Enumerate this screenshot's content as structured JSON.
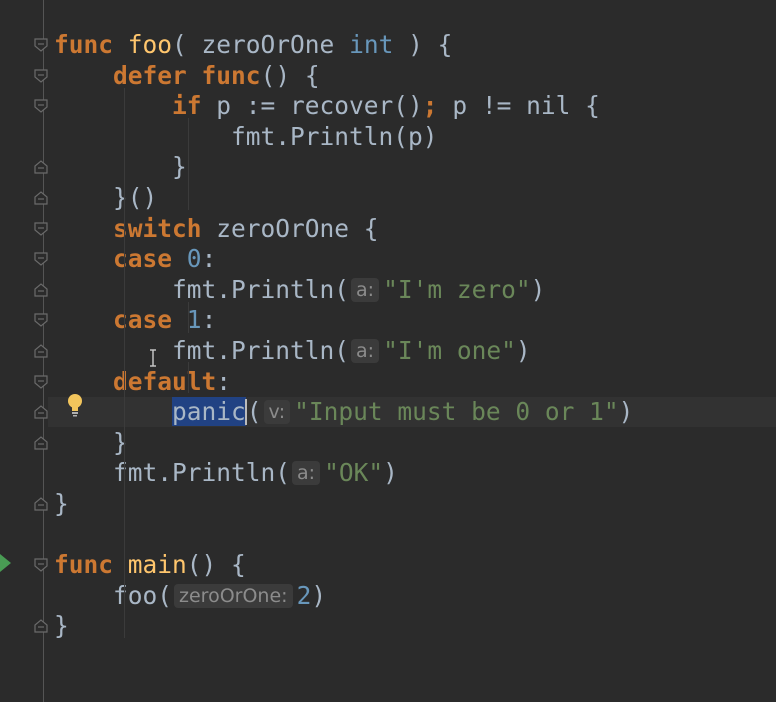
{
  "editor": {
    "lines": [
      {
        "tokens": [
          {
            "t": "func",
            "c": "kw"
          },
          {
            "t": " "
          },
          {
            "t": "foo",
            "c": "fn"
          },
          {
            "t": "( zeroOrOne "
          },
          {
            "t": "int",
            "c": "num"
          },
          {
            "t": " ) {"
          }
        ]
      },
      {
        "tokens": [
          {
            "t": "    "
          },
          {
            "t": "defer",
            "c": "kw"
          },
          {
            "t": " "
          },
          {
            "t": "func",
            "c": "kw"
          },
          {
            "t": "() {"
          }
        ]
      },
      {
        "tokens": [
          {
            "t": "        "
          },
          {
            "t": "if",
            "c": "kw"
          },
          {
            "t": " p := recover()"
          },
          {
            "t": ";",
            "c": "kw"
          },
          {
            "t": " p != nil {"
          }
        ]
      },
      {
        "tokens": [
          {
            "t": "            fmt.Println(p)"
          }
        ]
      },
      {
        "tokens": [
          {
            "t": "        }"
          }
        ]
      },
      {
        "tokens": [
          {
            "t": "    }()"
          }
        ]
      },
      {
        "tokens": [
          {
            "t": "    "
          },
          {
            "t": "switch",
            "c": "kw"
          },
          {
            "t": " zeroOrOne {"
          }
        ]
      },
      {
        "tokens": [
          {
            "t": "    "
          },
          {
            "t": "case",
            "c": "kw"
          },
          {
            "t": " "
          },
          {
            "t": "0",
            "c": "num"
          },
          {
            "t": ":"
          }
        ]
      },
      {
        "tokens": [
          {
            "t": "        fmt.Println("
          },
          {
            "t": "a:",
            "c": "hint"
          },
          {
            "t": "\"I'm zero\"",
            "c": "str"
          },
          {
            "t": ")"
          }
        ]
      },
      {
        "tokens": [
          {
            "t": "    "
          },
          {
            "t": "case",
            "c": "kw"
          },
          {
            "t": " "
          },
          {
            "t": "1",
            "c": "num"
          },
          {
            "t": ":"
          }
        ]
      },
      {
        "tokens": [
          {
            "t": "        fmt.Println("
          },
          {
            "t": "a:",
            "c": "hint"
          },
          {
            "t": "\"I'm one\"",
            "c": "str"
          },
          {
            "t": ")"
          }
        ]
      },
      {
        "tokens": [
          {
            "t": "    "
          },
          {
            "t": "default",
            "c": "kw"
          },
          {
            "t": ":"
          }
        ]
      },
      {
        "current": true,
        "tokens": [
          {
            "t": "        "
          },
          {
            "t": "panic",
            "c": "sel"
          },
          {
            "t": "",
            "c": "caret"
          },
          {
            "t": "("
          },
          {
            "t": "v:",
            "c": "hint"
          },
          {
            "t": "\"Input must be 0 or 1\"",
            "c": "str"
          },
          {
            "t": ")"
          }
        ]
      },
      {
        "tokens": [
          {
            "t": "    }"
          }
        ]
      },
      {
        "tokens": [
          {
            "t": "    fmt.Println("
          },
          {
            "t": "a:",
            "c": "hint"
          },
          {
            "t": "\"OK\"",
            "c": "str"
          },
          {
            "t": ")"
          }
        ]
      },
      {
        "tokens": [
          {
            "t": "}"
          }
        ]
      },
      {
        "tokens": []
      },
      {
        "tokens": [
          {
            "t": "func",
            "c": "kw"
          },
          {
            "t": " "
          },
          {
            "t": "main",
            "c": "fn"
          },
          {
            "t": "() {"
          }
        ]
      },
      {
        "tokens": [
          {
            "t": "    foo("
          },
          {
            "t": "zeroOrOne:",
            "c": "hint"
          },
          {
            "t": "2",
            "c": "num"
          },
          {
            "t": ")"
          }
        ]
      },
      {
        "tokens": [
          {
            "t": "}"
          }
        ]
      }
    ]
  },
  "colors": {
    "background": "#2b2b2b",
    "keyword": "#cc7832",
    "function": "#ffc66d",
    "string": "#6a8759",
    "number": "#6897bb",
    "text": "#a9b7c6",
    "selection": "#214283",
    "run_gutter": "#499c54"
  },
  "gutter_icons": {
    "fold": "fold-marker-icon",
    "intention": "lightbulb-icon",
    "run": "run-triangle-icon"
  }
}
